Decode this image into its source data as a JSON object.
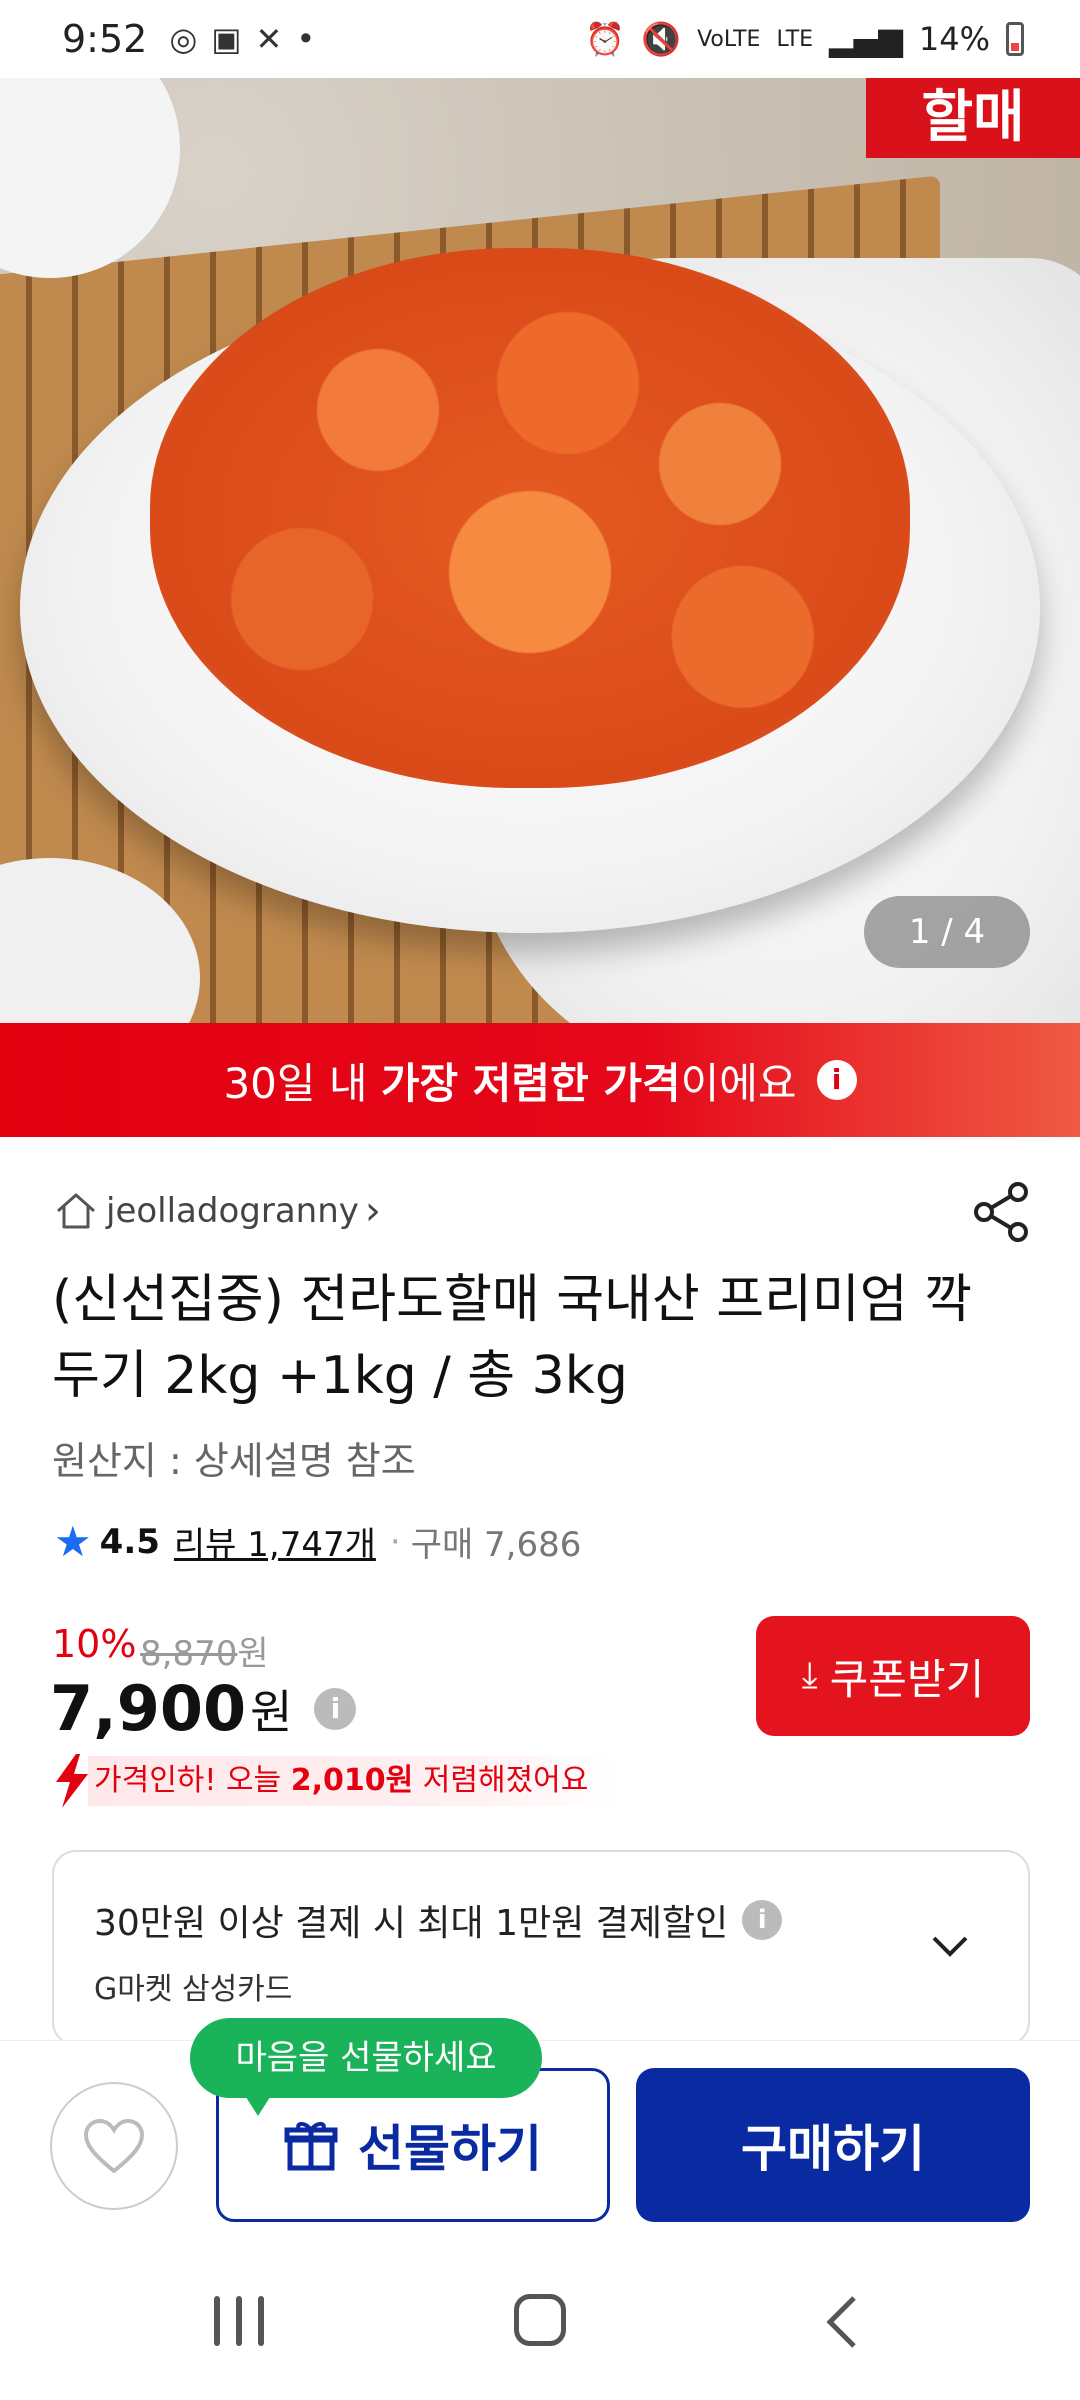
{
  "status_bar": {
    "time": "9:52",
    "battery": "14%",
    "icons": [
      "sync-icon",
      "image-icon",
      "missed-call-icon",
      "dot-icon",
      "alarm-icon",
      "mute-icon",
      "volte-icon",
      "lte-icon",
      "signal-icon",
      "battery-icon"
    ]
  },
  "hero": {
    "sign_text": "할매",
    "counter": "1 / 4"
  },
  "banner": {
    "prefix": "30일 내 ",
    "bold": "가장 저렴한 가격",
    "suffix": "이에요"
  },
  "seller": {
    "name": "jeolladogranny",
    "chevron": "›"
  },
  "product": {
    "title": "(신선집중) 전라도할매 국내산 프리미엄 깍두기 2kg +1kg / 총 3kg",
    "origin": "원산지 : 상세설명 참조"
  },
  "rating": {
    "score": "4.5",
    "reviews": "리뷰 1,747개",
    "separator": "·",
    "purchases": "구매 7,686"
  },
  "price": {
    "discount": "10%",
    "original": "8,870",
    "original_unit": "원",
    "current": "7,900",
    "current_unit": "원",
    "drop_prefix": "가격인하! 오늘 ",
    "drop_amount": "2,010원",
    "drop_suffix": " 저렴해졌어요"
  },
  "coupon_button": {
    "label": "쿠폰받기"
  },
  "card_discount": {
    "line1": "30만원 이상 결제 시 최대 1만원 결제할인",
    "line2": "G마켓 삼성카드"
  },
  "bottom": {
    "tooltip": "마음을 선물하세요",
    "gift_label": "선물하기",
    "buy_label": "구매하기"
  },
  "colors": {
    "brand_red": "#e3000f",
    "brand_blue": "#0a2aa2",
    "tooltip_green": "#1bb35a",
    "star_blue": "#1a6df2"
  }
}
